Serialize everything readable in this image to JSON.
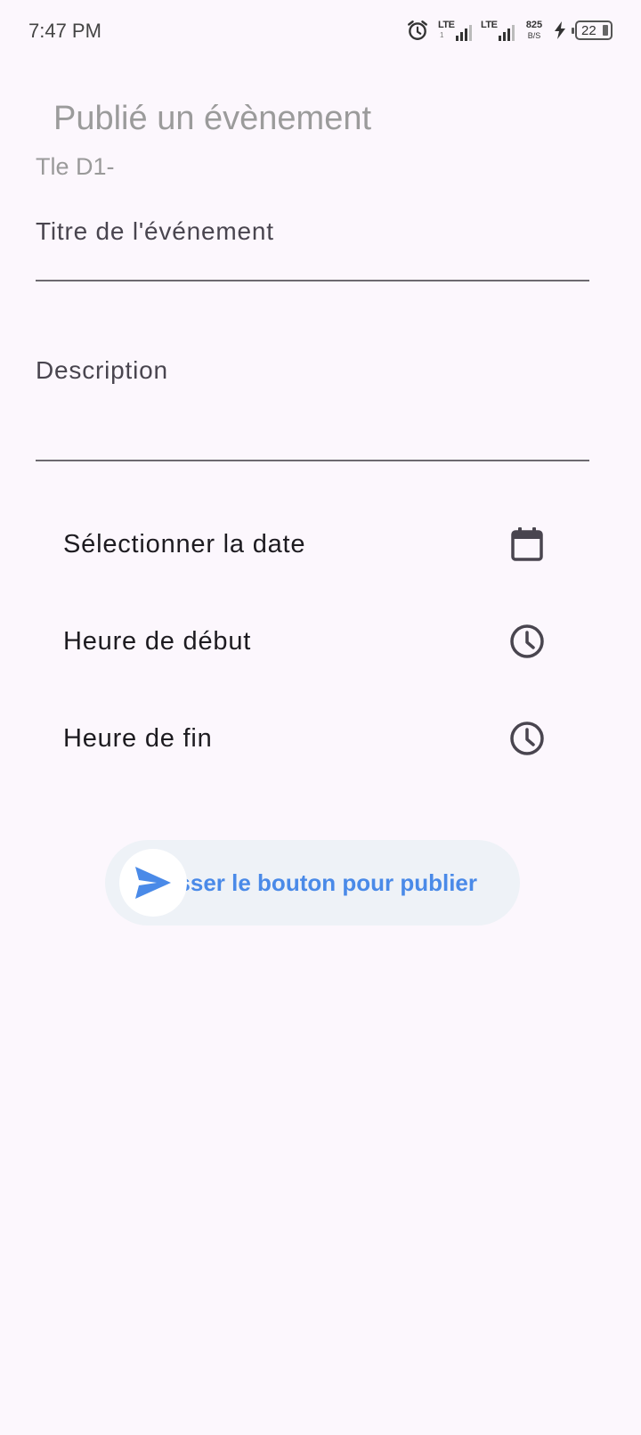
{
  "status_bar": {
    "time": "7:47 PM",
    "network_1": "LTE",
    "network_1_sub": "1",
    "network_2": "LTE",
    "speed_value": "825",
    "speed_unit": "B/S",
    "battery_level": "22",
    "icons": [
      "alarm-icon",
      "signal-icon",
      "signal-icon",
      "charging-icon",
      "battery-icon"
    ]
  },
  "header": {
    "title": "Publié un évènement",
    "subtitle": "Tle D1-"
  },
  "form": {
    "title_field_label": "Titre de l'événement",
    "description_field_label": "Description",
    "date_label": "Sélectionner la date",
    "date_icon": "calendar-icon",
    "start_time_label": "Heure de début",
    "start_time_icon": "clock-icon",
    "end_time_label": "Heure de fin",
    "end_time_icon": "clock-icon"
  },
  "publish": {
    "swipe_text": "Glisser le bouton pour publier",
    "knob_icon": "send-icon"
  },
  "colors": {
    "background": "#fcf7fd",
    "accent": "#4a8ae8",
    "swipe_track": "#eef2f7",
    "underline": "#6d6a70",
    "muted_text": "#9b9b9b"
  }
}
